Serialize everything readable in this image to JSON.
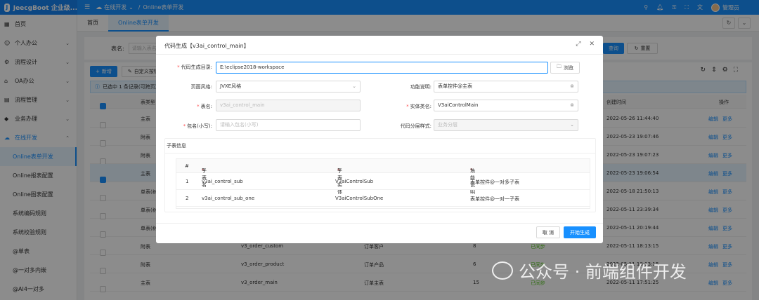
{
  "header": {
    "app_title": "JeecgBoot 企业级...",
    "breadcrumb_parent": "在线开发",
    "breadcrumb_sep": "/",
    "breadcrumb_current": "Online表单开发",
    "user_name": "管理员"
  },
  "sidebar": {
    "items": [
      {
        "label": "首页",
        "icon": "home-icon"
      },
      {
        "label": "个人办公",
        "icon": "user-icon"
      },
      {
        "label": "流程设计",
        "icon": "flow-icon"
      },
      {
        "label": "OA办公",
        "icon": "building-icon"
      },
      {
        "label": "流程管理",
        "icon": "chart-icon"
      },
      {
        "label": "业务办理",
        "icon": "diamond-icon"
      },
      {
        "label": "在线开发",
        "icon": "cloud-icon"
      }
    ],
    "sub_items": [
      "Online表单开发",
      "Online报表配置",
      "Online图表配置",
      "系统编码规则",
      "系统校验规则",
      "@单表",
      "@一对多内嵌",
      "@AI4一对多"
    ]
  },
  "tabs": [
    "首页",
    "Online表单开发"
  ],
  "search": {
    "label": "表名:",
    "placeholder": "请输入表名",
    "query": "查询",
    "reset": "重置"
  },
  "table": {
    "add_label": "新增",
    "custom_label": "自定义按钮",
    "selection_text": "已选中 1 条记录(可跨页)",
    "headers": {
      "table_type": "表类型",
      "create_time": "创建时间",
      "actions": "操作"
    },
    "rows": [
      {
        "type": "主表",
        "name": "",
        "desc": "",
        "ver": "",
        "sync": "",
        "time": "2022-05-26 11:44:40"
      },
      {
        "type": "附表",
        "name": "",
        "desc": "",
        "ver": "",
        "sync": "",
        "time": "2022-05-23 19:07:46"
      },
      {
        "type": "附表",
        "name": "",
        "desc": "",
        "ver": "",
        "sync": "",
        "time": "2022-05-23 19:07:23"
      },
      {
        "type": "主表",
        "name": "",
        "desc": "",
        "ver": "",
        "sync": "",
        "time": "2022-05-23 19:06:54"
      },
      {
        "type": "单表(树)",
        "name": "",
        "desc": "",
        "ver": "",
        "sync": "",
        "time": "2022-05-18 21:50:13"
      },
      {
        "type": "单表(树)",
        "name": "",
        "desc": "",
        "ver": "",
        "sync": "",
        "time": "2022-05-11 23:39:34"
      },
      {
        "type": "单表(树)",
        "name": "",
        "desc": "",
        "ver": "",
        "sync": "",
        "time": "2022-05-11 20:19:44"
      },
      {
        "type": "附表",
        "name": "v3_order_custom",
        "desc": "订单客户",
        "ver": "8",
        "sync": "已同步",
        "time": "2022-05-11 18:13:15"
      },
      {
        "type": "附表",
        "name": "v3_order_product",
        "desc": "订单产品",
        "ver": "6",
        "sync": "已同步",
        "time": "2022-05-11 18:13:15"
      },
      {
        "type": "主表",
        "name": "v3_order_main",
        "desc": "订单主表",
        "ver": "15",
        "sync": "已同步",
        "time": "2022-05-11 17:51:25"
      }
    ],
    "edit": "编辑",
    "more": "更多"
  },
  "modal": {
    "title": "代码生成【v3ai_control_main】",
    "labels": {
      "output_dir": "代码生成目录:",
      "page_style": "页面风格:",
      "func_desc": "功能说明:",
      "table_name": "表名:",
      "entity_name": "实体类名:",
      "package": "包名(小写):",
      "layer_style": "代码分层样式:"
    },
    "values": {
      "output_dir": "E:\\eclipse2018-workspace",
      "page_style": "JVXE风格",
      "func_desc": "表单控件@主表",
      "table_name": "v3ai_control_main",
      "entity_name": "V3aiControlMain",
      "package_placeholder": "请输入包名(小写)",
      "layer_style": "业务分层"
    },
    "browse": "浏览",
    "sub_section_title": "子表信息",
    "sub_headers": {
      "index": "#",
      "name": "子表名",
      "entity": "子表实体",
      "desc": "功能说明"
    },
    "sub_rows": [
      {
        "index": "1",
        "name": "v3ai_control_sub",
        "entity": "V3aiControlSub",
        "desc": "表单控件@一对多子表"
      },
      {
        "index": "2",
        "name": "v3ai_control_sub_one",
        "entity": "V3aiControlSubOne",
        "desc": "表单控件@一对一子表"
      }
    ],
    "cancel": "取 消",
    "ok": "开始生成"
  },
  "watermark": "公众号 · 前端组件开发"
}
